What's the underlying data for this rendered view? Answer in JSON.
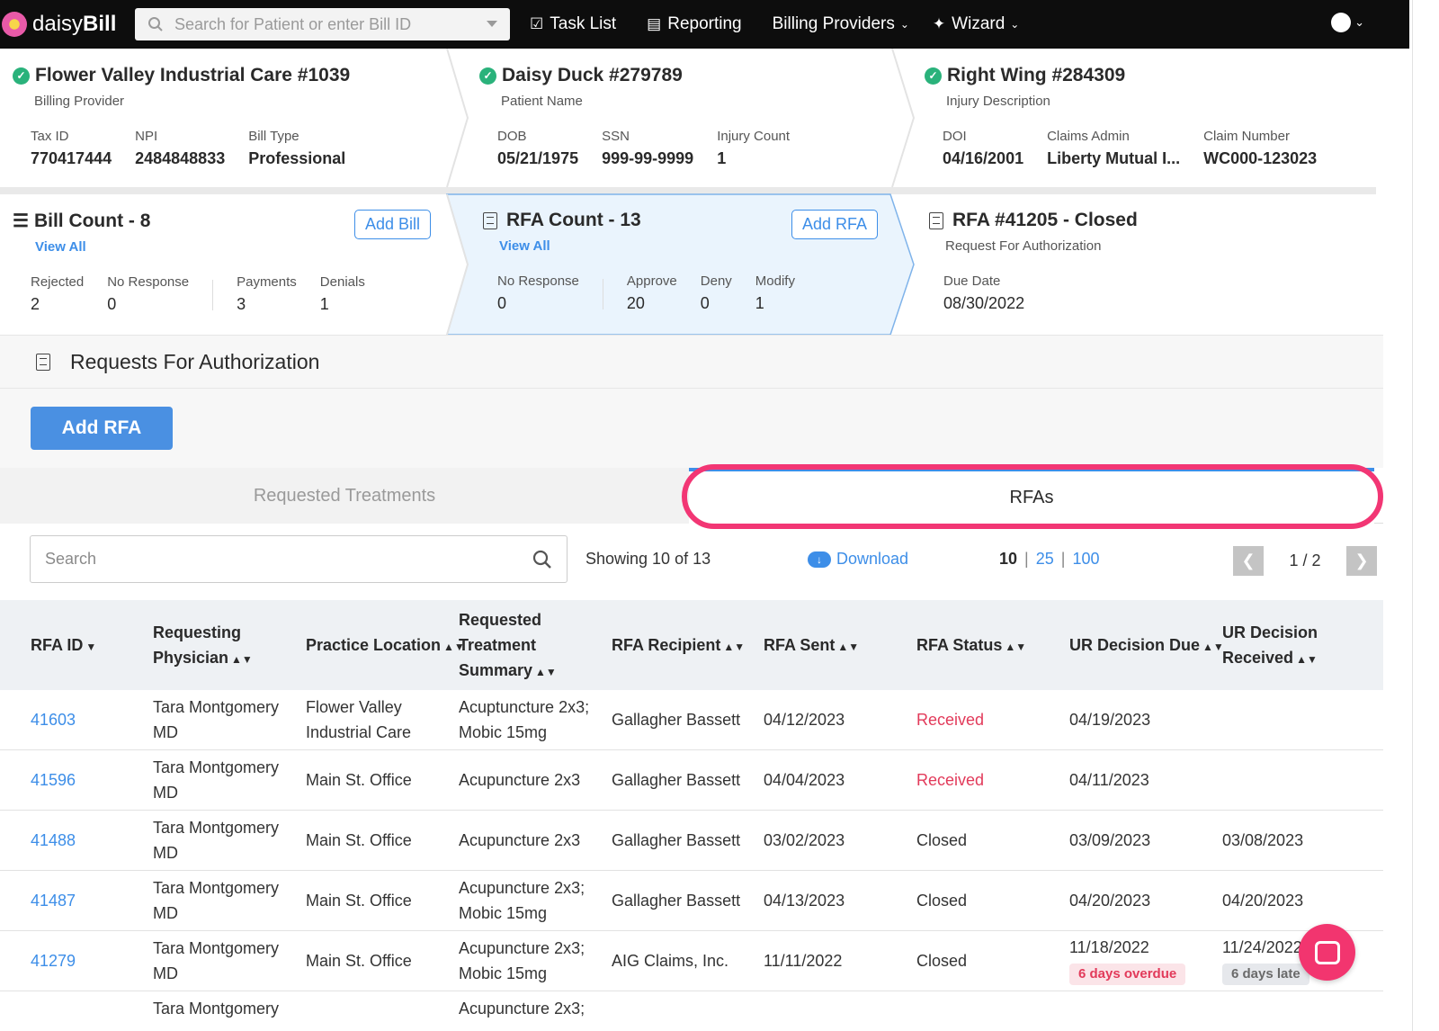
{
  "nav": {
    "logo_daisy": "daisy",
    "logo_bill": "Bill",
    "search_placeholder": "Search for Patient or enter Bill ID",
    "task_list": "Task List",
    "reporting": "Reporting",
    "billing_providers": "Billing Providers",
    "wizard": "Wizard"
  },
  "provider": {
    "title": "Flower Valley Industrial Care #1039",
    "subtitle": "Billing Provider",
    "fields": [
      {
        "label": "Tax ID",
        "value": "770417444"
      },
      {
        "label": "NPI",
        "value": "2484848833"
      },
      {
        "label": "Bill Type",
        "value": "Professional"
      }
    ]
  },
  "patient": {
    "title": "Daisy Duck #279789",
    "subtitle": "Patient Name",
    "fields": [
      {
        "label": "DOB",
        "value": "05/21/1975"
      },
      {
        "label": "SSN",
        "value": "999-99-9999"
      },
      {
        "label": "Injury Count",
        "value": "1"
      }
    ]
  },
  "injury": {
    "title": "Right Wing #284309",
    "subtitle": "Injury Description",
    "fields": [
      {
        "label": "DOI",
        "value": "04/16/2001"
      },
      {
        "label": "Claims Admin",
        "value": "Liberty Mutual I..."
      },
      {
        "label": "Claim Number",
        "value": "WC000-123023"
      }
    ]
  },
  "bills": {
    "title": "Bill Count - 8",
    "view_all": "View All",
    "add_button": "Add Bill",
    "fields": [
      {
        "label": "Rejected",
        "value": "2"
      },
      {
        "label": "No Response",
        "value": "0"
      },
      {
        "label": "Payments",
        "value": "3"
      },
      {
        "label": "Denials",
        "value": "1"
      }
    ]
  },
  "rfa_count": {
    "title": "RFA Count - 13",
    "view_all": "View All",
    "add_button": "Add RFA",
    "fields": [
      {
        "label": "No Response",
        "value": "0"
      },
      {
        "label": "Approve",
        "value": "20"
      },
      {
        "label": "Deny",
        "value": "0"
      },
      {
        "label": "Modify",
        "value": "1"
      }
    ]
  },
  "rfa_current": {
    "title": "RFA #41205 - Closed",
    "subtitle": "Request For Authorization",
    "due_label": "Due Date",
    "due_value": "08/30/2022"
  },
  "section": {
    "title": "Requests For Authorization",
    "add_button": "Add RFA",
    "tab_treatments": "Requested Treatments",
    "tab_rfas": "RFAs"
  },
  "toolbar": {
    "search_placeholder": "Search",
    "showing": "Showing 10 of 13",
    "download": "Download",
    "page_size_current": "10",
    "page_size_25": "25",
    "page_size_100": "100",
    "sep": "|",
    "page": "1 / 2"
  },
  "table": {
    "headers": {
      "rfa_id": "RFA ID",
      "physician_1": "Requesting",
      "physician_2": "Physician",
      "location": "Practice Location",
      "summary_1": "Requested",
      "summary_2": "Treatment",
      "summary_3": "Summary",
      "recipient": "RFA Recipient",
      "sent": "RFA Sent",
      "status": "RFA Status",
      "due": "UR Decision Due",
      "received_1": "UR Decision",
      "received_2": "Received"
    },
    "rows": [
      {
        "id": "41603",
        "phys1": "Tara Montgomery",
        "phys2": "MD",
        "loc1": "Flower Valley",
        "loc2": "Industrial Care",
        "sum1": "Acuptuncture 2x3;",
        "sum2": "Mobic 15mg",
        "recipient": "Gallagher Bassett",
        "sent": "04/12/2023",
        "status": "Received",
        "due": "04/19/2023",
        "received": ""
      },
      {
        "id": "41596",
        "phys1": "Tara Montgomery",
        "phys2": "MD",
        "loc1": "Main St. Office",
        "loc2": "",
        "sum1": "Acupuncture 2x3",
        "sum2": "",
        "recipient": "Gallagher Bassett",
        "sent": "04/04/2023",
        "status": "Received",
        "due": "04/11/2023",
        "received": ""
      },
      {
        "id": "41488",
        "phys1": "Tara Montgomery",
        "phys2": "MD",
        "loc1": "Main St. Office",
        "loc2": "",
        "sum1": "Acupuncture 2x3",
        "sum2": "",
        "recipient": "Gallagher Bassett",
        "sent": "03/02/2023",
        "status": "Closed",
        "due": "03/09/2023",
        "received": "03/08/2023"
      },
      {
        "id": "41487",
        "phys1": "Tara Montgomery",
        "phys2": "MD",
        "loc1": "Main St. Office",
        "loc2": "",
        "sum1": "Acupuncture 2x3;",
        "sum2": "Mobic 15mg",
        "recipient": "Gallagher Bassett",
        "sent": "04/13/2023",
        "status": "Closed",
        "due": "04/20/2023",
        "received": "04/20/2023"
      },
      {
        "id": "41279",
        "phys1": "Tara Montgomery",
        "phys2": "MD",
        "loc1": "Main St. Office",
        "loc2": "",
        "sum1": "Acupuncture 2x3;",
        "sum2": "Mobic 15mg",
        "recipient": "AIG Claims, Inc.",
        "sent": "11/11/2022",
        "status": "Closed",
        "due": "11/18/2022",
        "due_badge": "6 days overdue",
        "received": "11/24/2022",
        "received_badge": "6 days late"
      },
      {
        "id": "",
        "phys1": "Tara Montgomery",
        "phys2": "",
        "loc1": "",
        "loc2": "",
        "sum1": "Acupuncture 2x3;",
        "sum2": "",
        "recipient": "",
        "sent": "",
        "status": "",
        "due": "",
        "received": ""
      }
    ]
  },
  "colors": {
    "accent": "#3d8ee8",
    "highlight": "#f23674",
    "received_status": "#e23a5a",
    "success": "#2ab27b"
  }
}
